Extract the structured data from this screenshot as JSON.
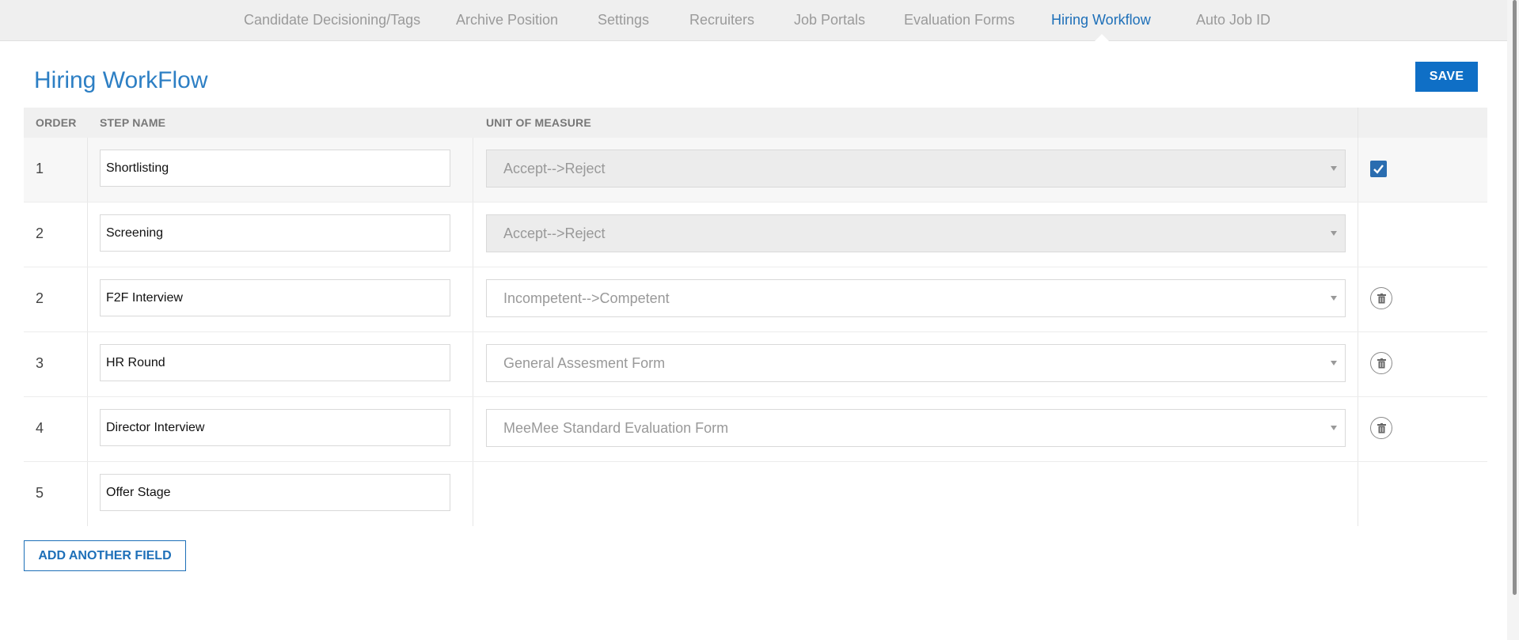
{
  "nav": {
    "tabs": [
      {
        "label": "Candidate Decisioning/Tags",
        "active": false
      },
      {
        "label": "Archive Position",
        "active": false
      },
      {
        "label": "Settings",
        "active": false
      },
      {
        "label": "Recruiters",
        "active": false
      },
      {
        "label": "Job Portals",
        "active": false
      },
      {
        "label": "Evaluation Forms",
        "active": false
      },
      {
        "label": "Hiring Workflow",
        "active": true
      },
      {
        "label": "Auto Job ID",
        "active": false
      }
    ]
  },
  "page": {
    "title": "Hiring WorkFlow",
    "save_label": "SAVE",
    "add_label": "ADD ANOTHER FIELD"
  },
  "table": {
    "headers": {
      "order": "ORDER",
      "step_name": "STEP NAME",
      "unit_of_measure": "UNIT OF MEASURE"
    },
    "rows": [
      {
        "order": "1",
        "step_name": "Shortlisting",
        "unit": "Accept-->Reject",
        "unit_disabled": true,
        "action": "checkbox-checked"
      },
      {
        "order": "2",
        "step_name": "Screening",
        "unit": "Accept-->Reject",
        "unit_disabled": true,
        "action": "none"
      },
      {
        "order": "2",
        "step_name": "F2F Interview",
        "unit": "Incompetent-->Competent",
        "unit_disabled": false,
        "action": "trash-icon"
      },
      {
        "order": "3",
        "step_name": "HR Round",
        "unit": "General Assesment Form",
        "unit_disabled": false,
        "action": "trash-icon"
      },
      {
        "order": "4",
        "step_name": "Director Interview",
        "unit": "MeeMee Standard Evaluation Form",
        "unit_disabled": false,
        "action": "trash-icon"
      },
      {
        "order": "5",
        "step_name": "Offer Stage",
        "unit": "",
        "unit_disabled": false,
        "action": "none"
      }
    ]
  },
  "colors": {
    "accent": "#1d6fb8",
    "save_button": "#0f6fc6",
    "checkbox": "#2a6db0",
    "nav_bg": "#efefef",
    "inactive_tab": "#9a9a9a"
  }
}
